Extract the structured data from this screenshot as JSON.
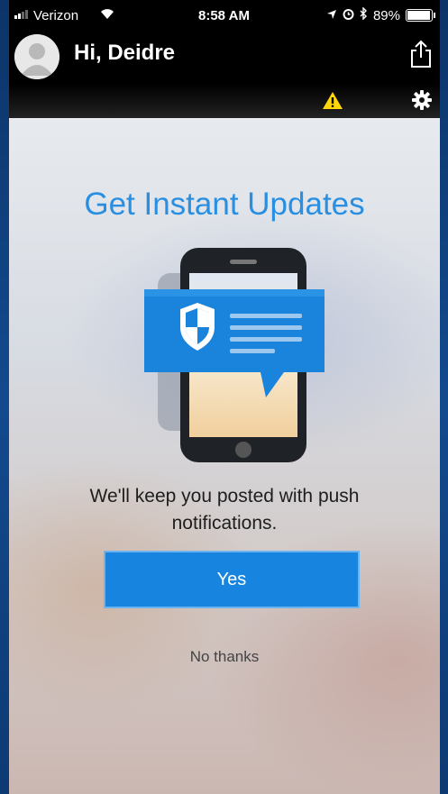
{
  "status_bar": {
    "carrier": "Verizon",
    "time": "8:58 AM",
    "battery_percent": "89%",
    "battery_level": 0.89,
    "icons": [
      "signal-icon",
      "wifi-icon",
      "location-arrow-icon",
      "alarm-icon",
      "bluetooth-icon",
      "battery-icon"
    ]
  },
  "header": {
    "greeting": "Hi, Deidre",
    "icons": [
      "avatar",
      "share-icon",
      "warning-icon",
      "gear-icon"
    ]
  },
  "prompt": {
    "title": "Get Instant Updates",
    "message": "We'll keep you posted with push notifications.",
    "yes_label": "Yes",
    "no_label": "No thanks"
  },
  "colors": {
    "accent": "#1785df",
    "title": "#2a8fe0",
    "warning": "#ffd60a",
    "frame": "#0f3f7a"
  }
}
